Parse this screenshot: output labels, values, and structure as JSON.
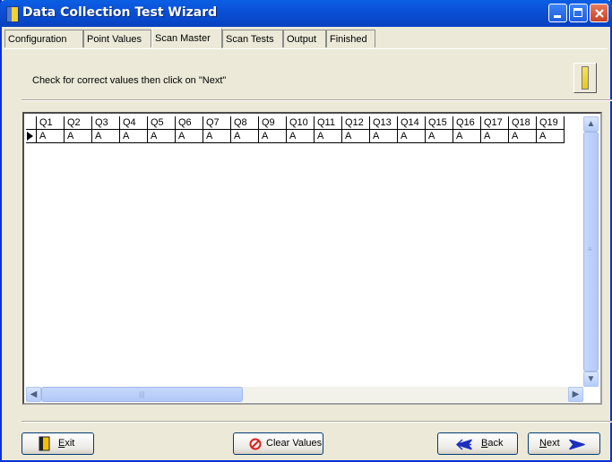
{
  "window": {
    "title": "Data Collection Test Wizard"
  },
  "tabs": [
    {
      "label": "Configuration",
      "active": false
    },
    {
      "label": "Point Values",
      "active": false
    },
    {
      "label": "Scan Master",
      "active": true
    },
    {
      "label": "Scan Tests",
      "active": false
    },
    {
      "label": "Output",
      "active": false
    },
    {
      "label": "Finished",
      "active": false
    }
  ],
  "main": {
    "instruction": "Check for correct values then click on \"Next\"",
    "grid": {
      "columns": [
        "Q1",
        "Q2",
        "Q3",
        "Q4",
        "Q5",
        "Q6",
        "Q7",
        "Q8",
        "Q9",
        "Q10",
        "Q11",
        "Q12",
        "Q13",
        "Q14",
        "Q15",
        "Q16",
        "Q17",
        "Q18",
        "Q19"
      ],
      "rows": [
        [
          "A",
          "A",
          "A",
          "A",
          "A",
          "A",
          "A",
          "A",
          "A",
          "A",
          "A",
          "A",
          "A",
          "A",
          "A",
          "A",
          "A",
          "A",
          "A"
        ]
      ]
    }
  },
  "buttons": {
    "exit": {
      "prefix": "E",
      "rest": "xit"
    },
    "clear": "Clear Values",
    "back": {
      "prefix": "B",
      "rest": "ack"
    },
    "next": {
      "prefix": "N",
      "rest": "ext"
    }
  },
  "icons": {
    "app": "app-icon",
    "pencil": "pencil-icon",
    "exit": "door-icon",
    "clear": "no-entry-icon",
    "back": "arrow-left-icon",
    "next": "arrow-right-icon"
  },
  "colors": {
    "titlebar": "#0a4fd6",
    "back_arrow": "#1c2fbf",
    "next_arrow": "#1c2fbf",
    "clear_icon": "#e02020"
  }
}
